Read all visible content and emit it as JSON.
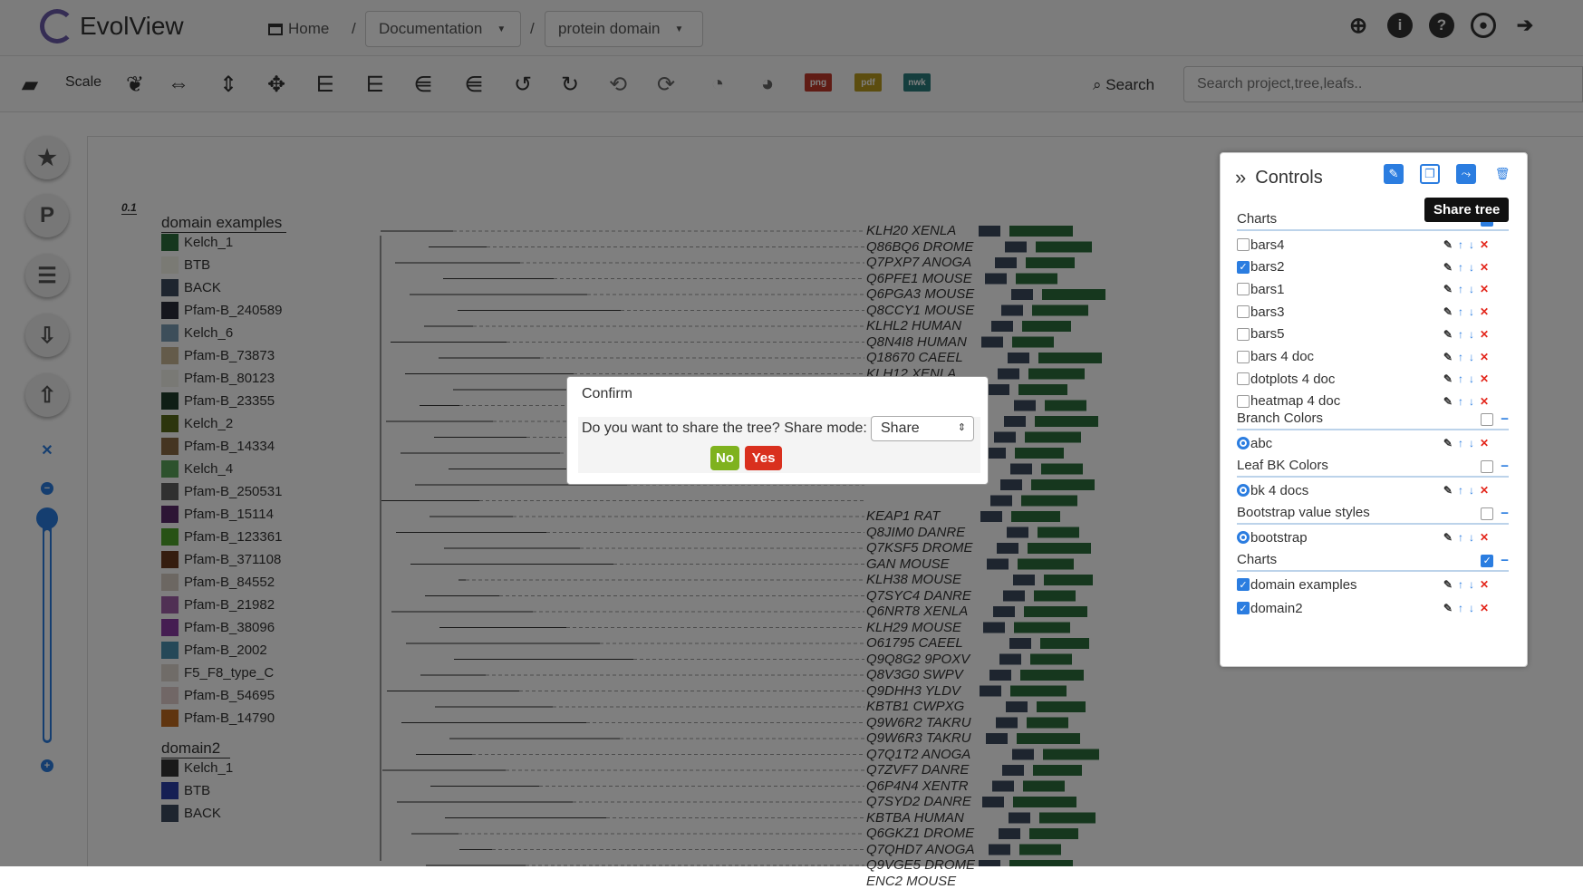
{
  "app": {
    "title": "EvolView"
  },
  "nav": {
    "home": "Home",
    "sep1": "/",
    "crumb1": "Documentation",
    "sep2": "/",
    "crumb2": "protein domain"
  },
  "toolbar": {
    "scale": "Scale",
    "search_label": "Search",
    "search_placeholder": "Search project,tree,leafs..",
    "png": "png",
    "pdf": "pdf",
    "nwk": "nwk"
  },
  "canvas": {
    "scale_bar": "0.1"
  },
  "legend1": {
    "title": "domain examples",
    "items": [
      {
        "label": "Kelch_1",
        "color": "#2d6e3d"
      },
      {
        "label": "BTB",
        "color": "#f5f5e8"
      },
      {
        "label": "BACK",
        "color": "#3d4b5e"
      },
      {
        "label": "Pfam-B_240589",
        "color": "#2b2d3a"
      },
      {
        "label": "Kelch_6",
        "color": "#7a9cb5"
      },
      {
        "label": "Pfam-B_73873",
        "color": "#c9b694"
      },
      {
        "label": "Pfam-B_80123",
        "color": "#f2f2ea"
      },
      {
        "label": "Pfam-B_23355",
        "color": "#1f3d2b"
      },
      {
        "label": "Kelch_2",
        "color": "#596a1a"
      },
      {
        "label": "Pfam-B_14334",
        "color": "#8a6a45"
      },
      {
        "label": "Kelch_4",
        "color": "#5aa55a"
      },
      {
        "label": "Pfam-B_250531",
        "color": "#606060"
      },
      {
        "label": "Pfam-B_15114",
        "color": "#5a2a6a"
      },
      {
        "label": "Pfam-B_123361",
        "color": "#4ea52a"
      },
      {
        "label": "Pfam-B_371108",
        "color": "#6a3a1e"
      },
      {
        "label": "Pfam-B_84552",
        "color": "#d8cfc5"
      },
      {
        "label": "Pfam-B_21982",
        "color": "#a060a8"
      },
      {
        "label": "Pfam-B_38096",
        "color": "#8a3aa5"
      },
      {
        "label": "Pfam-B_2002",
        "color": "#4a90b0"
      },
      {
        "label": "F5_F8_type_C",
        "color": "#e0d8d0"
      },
      {
        "label": "Pfam-B_54695",
        "color": "#e2cfcc"
      },
      {
        "label": "Pfam-B_14790",
        "color": "#c06a1e"
      }
    ]
  },
  "legend2": {
    "title": "domain2",
    "items": [
      {
        "label": "Kelch_1",
        "color": "#333333"
      },
      {
        "label": "BTB",
        "color": "#2b3fa8"
      },
      {
        "label": "BACK",
        "color": "#3d4b5e"
      }
    ]
  },
  "leaves": [
    "KLH20 XENLA",
    "Q86BQ6 DROME",
    "Q7PXP7 ANOGA",
    "Q6PFE1 MOUSE",
    "Q6PGA3 MOUSE",
    "Q8CCY1 MOUSE",
    "KLHL2 HUMAN",
    "Q8N4I8 HUMAN",
    "Q18670 CAEEL",
    "KLH12 XENLA",
    "",
    "",
    "",
    "",
    "",
    "",
    "",
    "",
    "KEAP1 RAT",
    "Q8JIM0 DANRE",
    "Q7KSF5 DROME",
    "GAN MOUSE",
    "KLH38 MOUSE",
    "Q7SYC4 DANRE",
    "Q6NRT8 XENLA",
    "KLH29 MOUSE",
    "O61795 CAEEL",
    "Q9Q8G2 9POXV",
    "Q8V3G0 SWPV",
    "Q9DHH3 YLDV",
    "KBTB1 CWPXG",
    "Q9W6R2 TAKRU",
    "Q9W6R3 TAKRU",
    "Q7Q1T2 ANOGA",
    "Q7ZVF7 DANRE",
    "Q6P4N4 XENTR",
    "Q7SYD2 DANRE",
    "KBTBA HUMAN",
    "Q6GKZ1 DROME",
    "Q7QHD7 ANOGA",
    "Q9VGE5 DROME",
    "ENC2 MOUSE"
  ],
  "dialog": {
    "title": "Confirm",
    "question": "Do you want to share the tree? Share mode:",
    "mode": "Share",
    "no": "No",
    "yes": "Yes"
  },
  "controls": {
    "title": "Controls",
    "tooltip": "Share tree",
    "sections": [
      {
        "label": "Charts",
        "checked": true
      },
      {
        "label": "Branch Colors",
        "checked": false
      },
      {
        "label": "Leaf BK Colors",
        "checked": false
      },
      {
        "label": "Bootstrap value styles",
        "checked": false
      },
      {
        "label": "Charts",
        "checked": true
      }
    ],
    "charts": [
      {
        "label": "bars4",
        "checked": false
      },
      {
        "label": "bars2",
        "checked": true
      },
      {
        "label": "bars1",
        "checked": false
      },
      {
        "label": "bars3",
        "checked": false
      },
      {
        "label": "bars5",
        "checked": false
      },
      {
        "label": "bars 4 doc",
        "checked": false
      },
      {
        "label": "dotplots 4 doc",
        "checked": false
      },
      {
        "label": "heatmap 4 doc",
        "checked": false
      }
    ],
    "branch_colors": [
      {
        "label": "abc"
      }
    ],
    "leaf_bk": [
      {
        "label": "bk 4 docs"
      }
    ],
    "bootstrap": [
      {
        "label": "bootstrap"
      }
    ],
    "charts2": [
      {
        "label": "domain examples",
        "checked": true
      },
      {
        "label": "domain2",
        "checked": true
      }
    ]
  }
}
